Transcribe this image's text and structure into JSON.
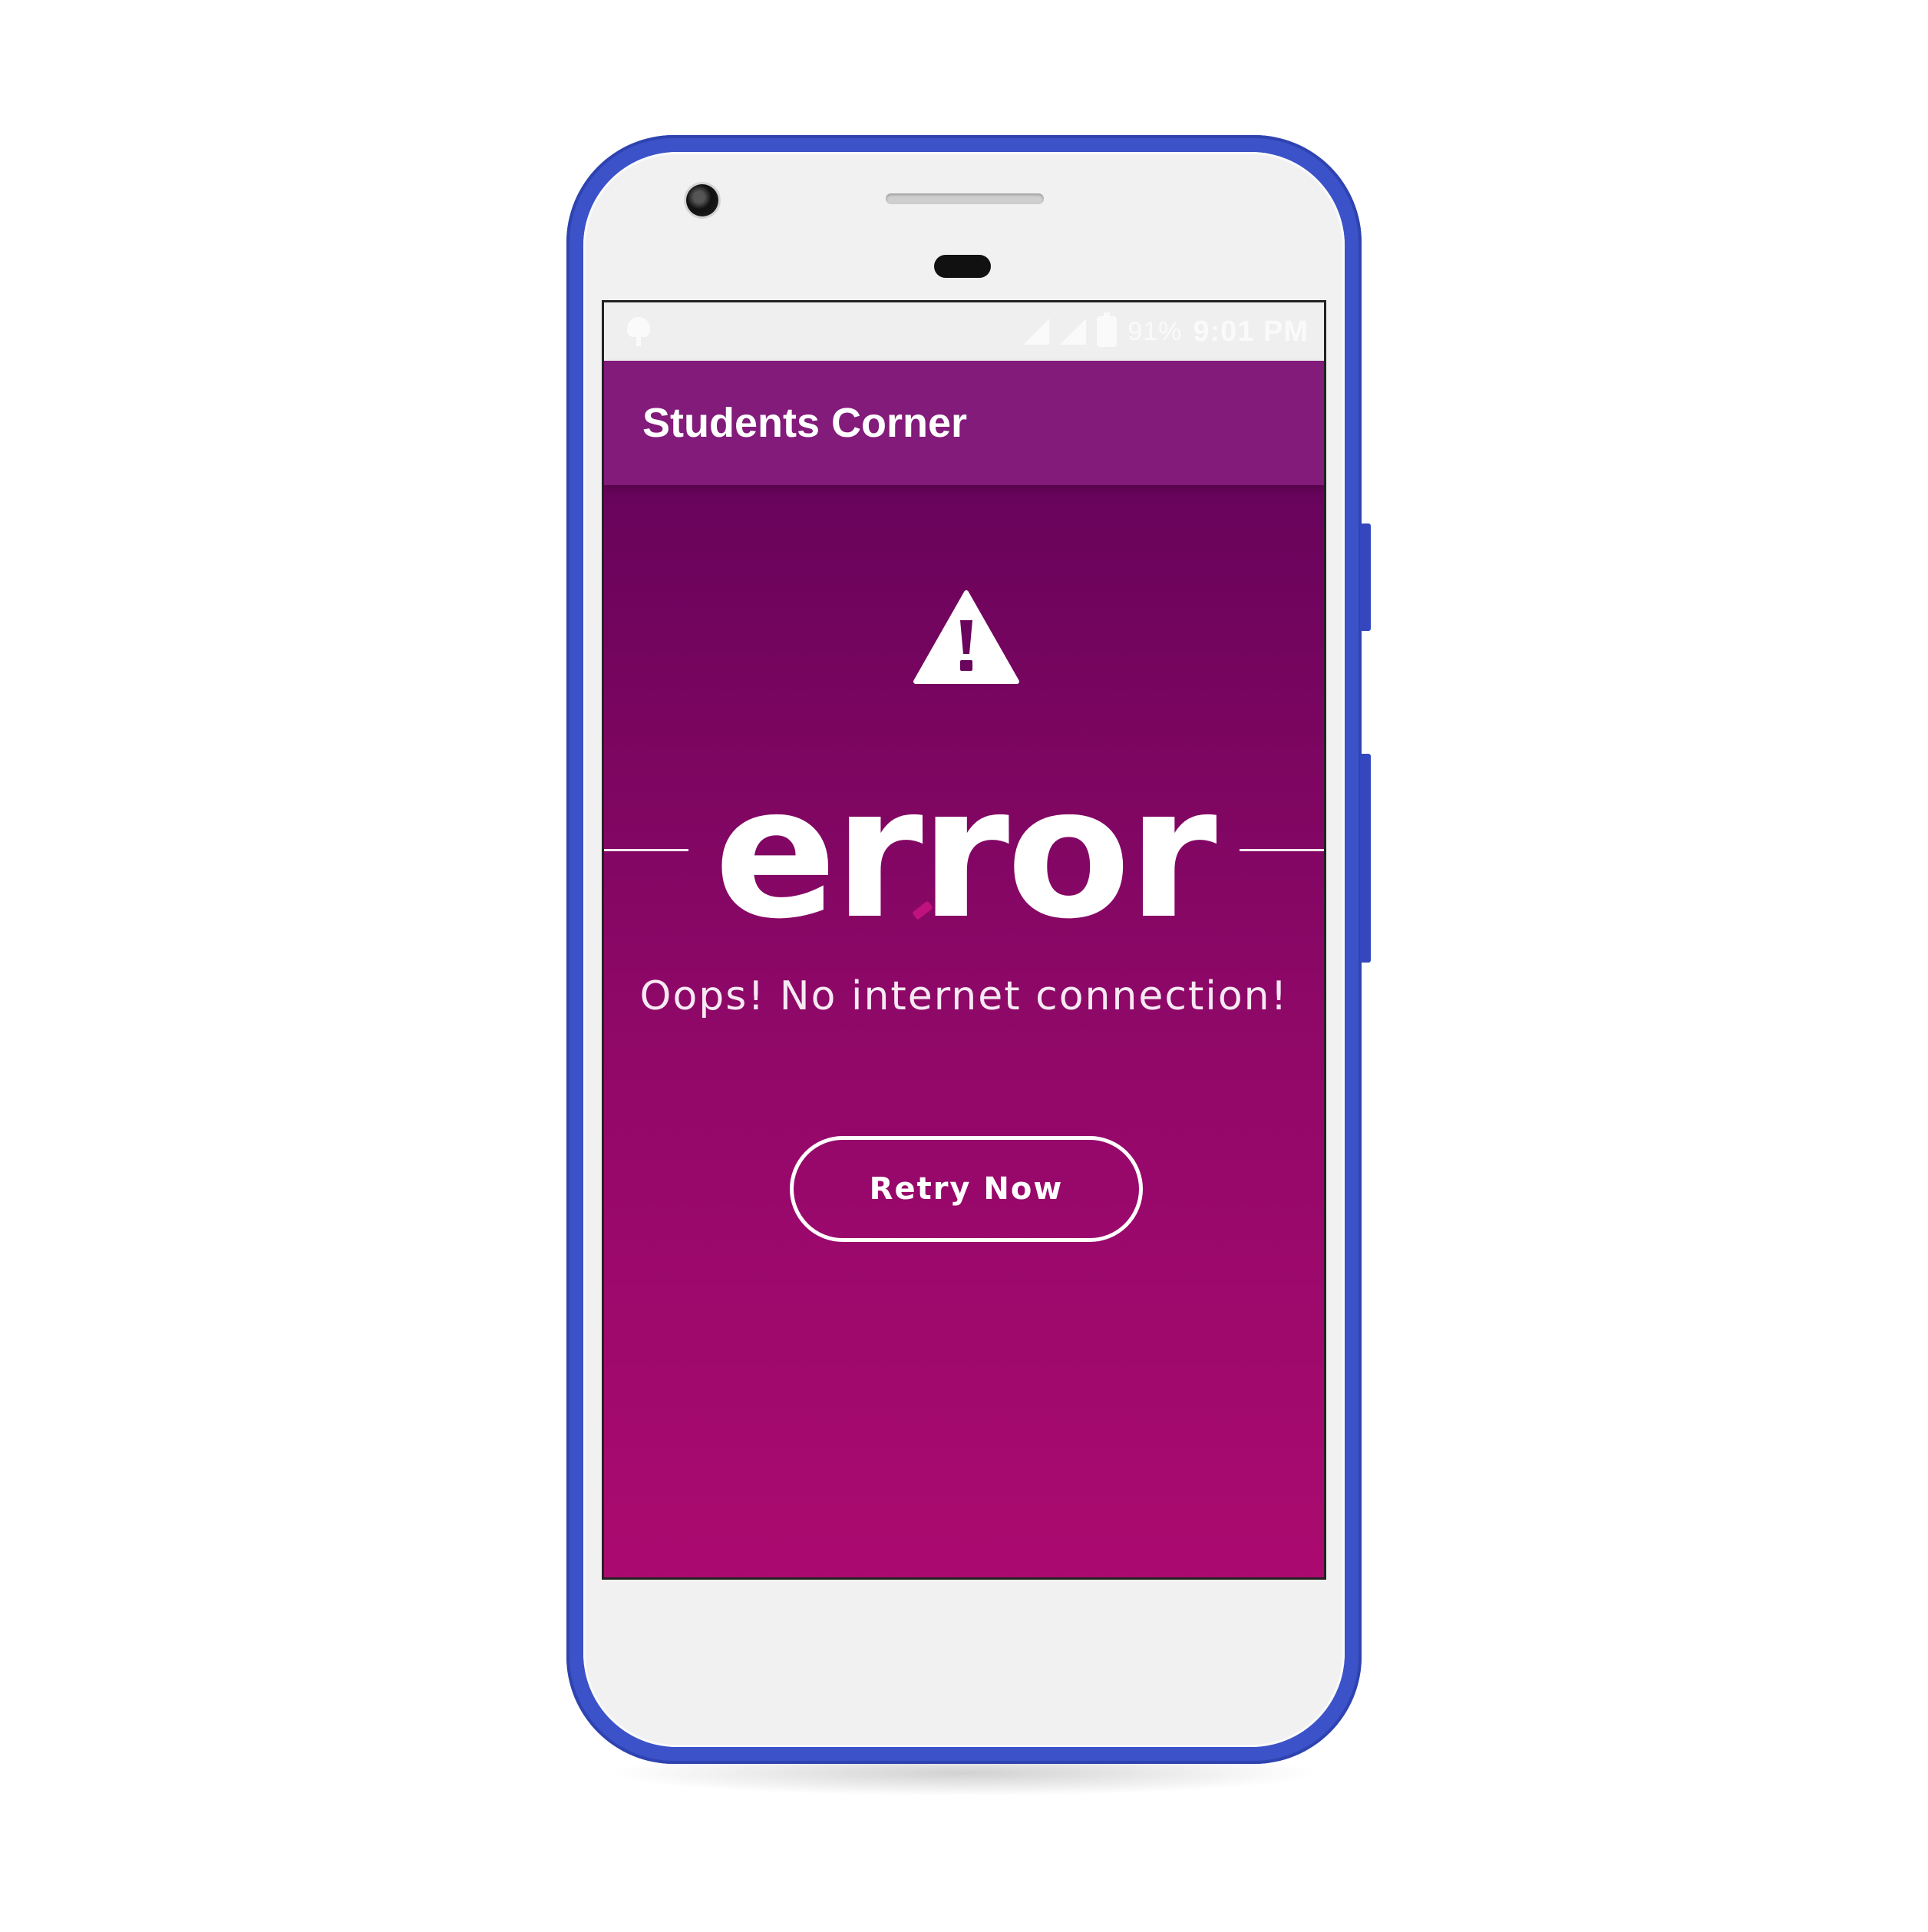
{
  "status_bar": {
    "battery_percent": "91%",
    "time": "9:01 PM",
    "icons": [
      "android-icon",
      "signal-icon",
      "signal-icon",
      "battery-charging-icon"
    ]
  },
  "app_bar": {
    "title": "Students Corner",
    "color": "#821b7a"
  },
  "error_screen": {
    "icon": "warning-icon",
    "heading": "error",
    "message": "Oops! No internet connection!",
    "retry_label": "Retry Now",
    "gradient_top": "#5a0358",
    "gradient_bottom": "#ab0a6f"
  },
  "device": {
    "frame_color": "#3c52c9"
  }
}
